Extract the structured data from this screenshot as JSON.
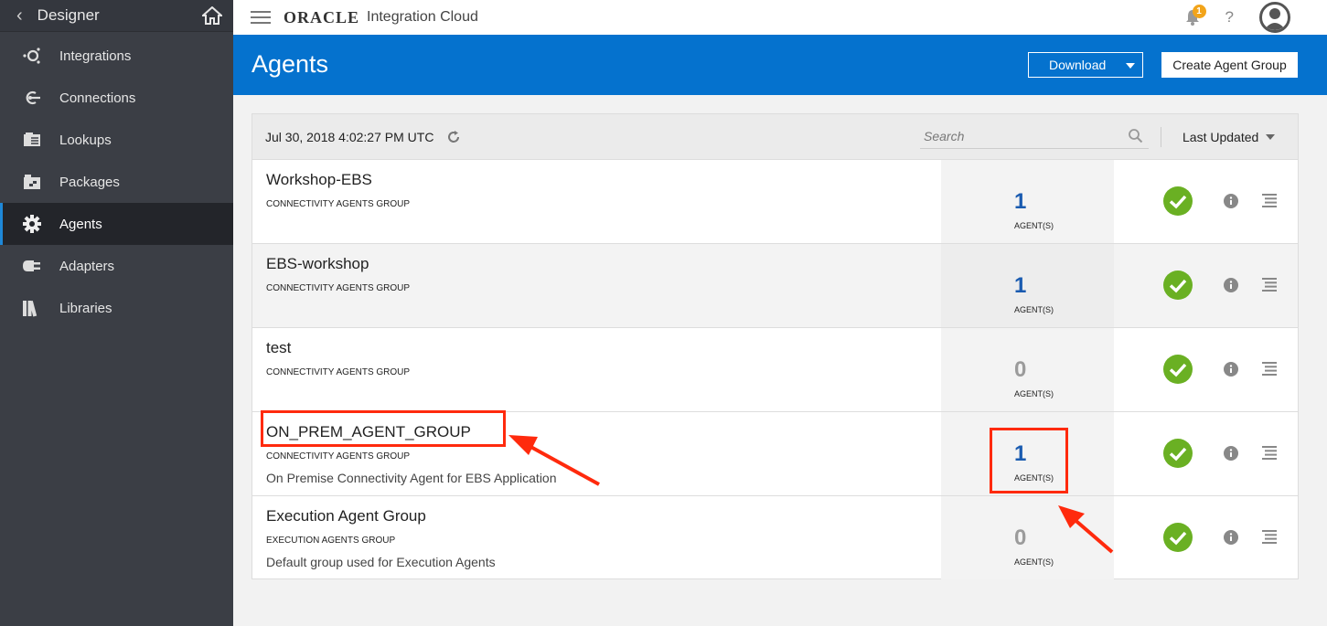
{
  "sidebar": {
    "header": {
      "title": "Designer",
      "back_icon": "chevron-left-icon",
      "home_icon": "home-icon"
    },
    "items": [
      {
        "label": "Integrations",
        "icon": "integrations-icon",
        "active": false
      },
      {
        "label": "Connections",
        "icon": "connections-icon",
        "active": false
      },
      {
        "label": "Lookups",
        "icon": "lookups-icon",
        "active": false
      },
      {
        "label": "Packages",
        "icon": "packages-icon",
        "active": false
      },
      {
        "label": "Agents",
        "icon": "gear-icon",
        "active": true
      },
      {
        "label": "Adapters",
        "icon": "plug-icon",
        "active": false
      },
      {
        "label": "Libraries",
        "icon": "libraries-icon",
        "active": false
      }
    ]
  },
  "topbar": {
    "brand": "ORACLE",
    "product": "Integration Cloud",
    "notification_count": "1",
    "help": "?"
  },
  "header": {
    "title": "Agents",
    "download_label": "Download",
    "create_label": "Create Agent Group"
  },
  "toolbar": {
    "timestamp": "Jul 30, 2018 4:02:27 PM UTC",
    "search_placeholder": "Search",
    "sort_label": "Last Updated"
  },
  "rows": [
    {
      "name": "Workshop-EBS",
      "type": "CONNECTIVITY AGENTS GROUP",
      "description": "",
      "count": "1",
      "count_label": "AGENT(S)"
    },
    {
      "name": "EBS-workshop",
      "type": "CONNECTIVITY AGENTS GROUP",
      "description": "",
      "count": "1",
      "count_label": "AGENT(S)"
    },
    {
      "name": "test",
      "type": "CONNECTIVITY AGENTS GROUP",
      "description": "",
      "count": "0",
      "count_label": "AGENT(S)"
    },
    {
      "name": "ON_PREM_AGENT_GROUP",
      "type": "CONNECTIVITY AGENTS GROUP",
      "description": "On Premise Connectivity Agent for EBS Application",
      "count": "1",
      "count_label": "AGENT(S)"
    },
    {
      "name": "Execution Agent Group",
      "type": "EXECUTION AGENTS GROUP",
      "description": "Default group used for Execution Agents",
      "count": "0",
      "count_label": "AGENT(S)"
    }
  ],
  "colors": {
    "accent": "#0572ce",
    "status_ok": "#6ab023",
    "annotation": "#ff2a0d",
    "sidebar": "#3b3e45"
  }
}
